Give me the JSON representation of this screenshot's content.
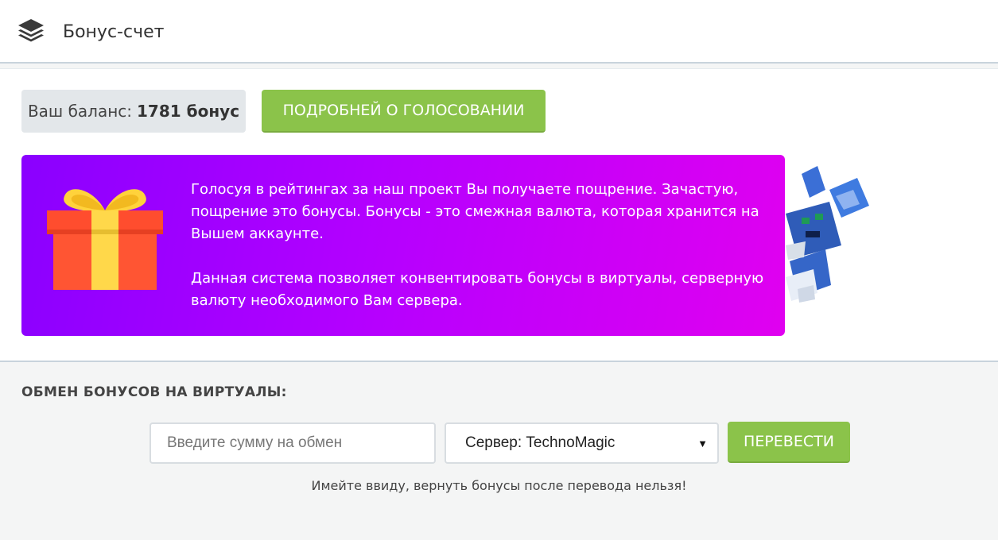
{
  "header": {
    "title": "Бонус-счет",
    "icon": "layers-icon"
  },
  "balance": {
    "label": "Ваш баланс:",
    "value": "1781 бонус"
  },
  "vote_button": "ПОДРОБНЕЙ О ГОЛОСОВАНИИ",
  "promo": {
    "icon": "gift-icon",
    "paragraph1": "Голосуя в рейтингах за наш проект Вы получаете пощрение. Зачастую, пощрение это бонусы. Бонусы - это смежная валюта, которая хранится на Вышем аккаунте.",
    "paragraph2": "Данная система позволяет конвентировать бонусы в виртуалы, серверную валюту необходимого Вам сервера."
  },
  "exchange": {
    "title": "ОБМЕН БОНУСОВ НА ВИРТУАЛЫ:",
    "amount_placeholder": "Введите сумму на обмен",
    "server_selected": "Сервер: TechnoMagic",
    "submit_label": "ПЕРЕВЕСТИ",
    "warning": "Имейте ввиду, вернуть бонусы после перевода нельзя!"
  },
  "colors": {
    "accent_green": "#8bc34a",
    "promo_gradient_start": "#8a00ff",
    "promo_gradient_end": "#e000f0"
  }
}
